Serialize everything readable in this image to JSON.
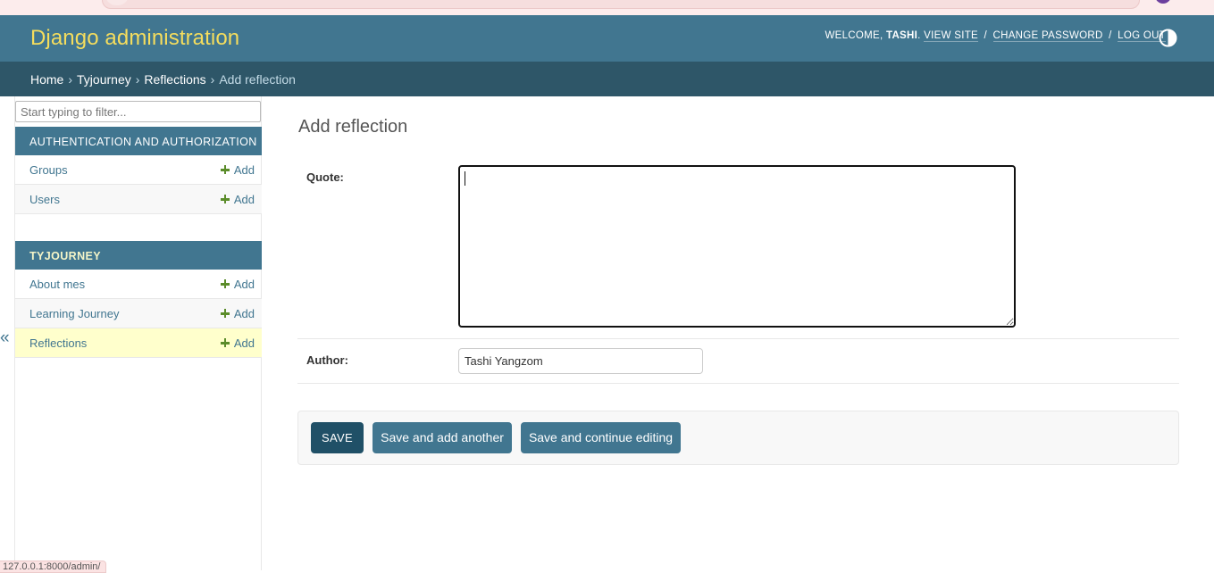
{
  "header": {
    "site_title": "Django administration",
    "welcome_prefix": "WELCOME,",
    "username": "TASHI",
    "view_site": "VIEW SITE",
    "change_password": "CHANGE PASSWORD",
    "log_out": "LOG OUT",
    "separator": "/",
    "theme_icon": "half-circle-contrast-icon"
  },
  "breadcrumbs": {
    "items": [
      "Home",
      "Tyjourney",
      "Reflections"
    ],
    "separator": "›",
    "current": "Add reflection"
  },
  "sidebar": {
    "filter_placeholder": "Start typing to filter...",
    "collapse_glyph": "«",
    "modules": [
      {
        "caption": "AUTHENTICATION AND AUTHORIZATION",
        "models": [
          {
            "name": "Groups",
            "add_label": "Add"
          },
          {
            "name": "Users",
            "add_label": "Add"
          }
        ]
      },
      {
        "caption": "TYJOURNEY",
        "models": [
          {
            "name": "About mes",
            "add_label": "Add"
          },
          {
            "name": "Learning Journey",
            "add_label": "Add"
          },
          {
            "name": "Reflections",
            "add_label": "Add"
          }
        ]
      }
    ],
    "current_model": "Reflections"
  },
  "main": {
    "title": "Add reflection",
    "fields": {
      "quote": {
        "label": "Quote:",
        "value": ""
      },
      "author": {
        "label": "Author:",
        "value": "Tashi Yangzom"
      }
    },
    "buttons": {
      "save": "SAVE",
      "save_add_another": "Save and add another",
      "save_continue": "Save and continue editing"
    }
  },
  "status_bar": {
    "url": "127.0.0.1:8000/admin/"
  },
  "colors": {
    "header_bg": "#417690",
    "breadcrumbs_bg": "#2e5668",
    "branding": "#f5dd5d",
    "link": "#417690",
    "add_icon": "#5b8c2a",
    "current_row": "#ffffcc",
    "save_button": "#205067"
  }
}
